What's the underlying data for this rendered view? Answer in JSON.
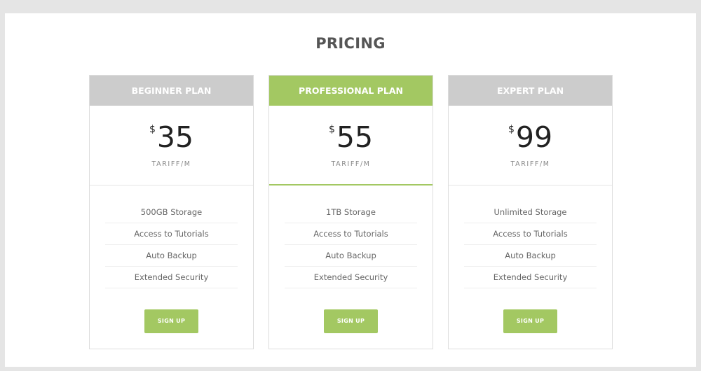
{
  "page": {
    "title": "PRICING"
  },
  "colors": {
    "accent": "#a3c862",
    "header_gray": "#cccccc",
    "background": "#e5e5e5"
  },
  "plans": [
    {
      "name": "BEGINNER PLAN",
      "currency": "$",
      "price": "35",
      "period": "TARIFF/M",
      "features": [
        "500GB Storage",
        "Access to Tutorials",
        "Auto Backup",
        "Extended Security"
      ],
      "button_label": "SIGN UP",
      "featured": false
    },
    {
      "name": "PROFESSIONAL PLAN",
      "currency": "$",
      "price": "55",
      "period": "TARIFF/M",
      "features": [
        "1TB Storage",
        "Access to Tutorials",
        "Auto Backup",
        "Extended Security"
      ],
      "button_label": "SIGN UP",
      "featured": true
    },
    {
      "name": "EXPERT PLAN",
      "currency": "$",
      "price": "99",
      "period": "TARIFF/M",
      "features": [
        "Unlimited Storage",
        "Access to Tutorials",
        "Auto Backup",
        "Extended Security"
      ],
      "button_label": "SIGN UP",
      "featured": false
    }
  ]
}
